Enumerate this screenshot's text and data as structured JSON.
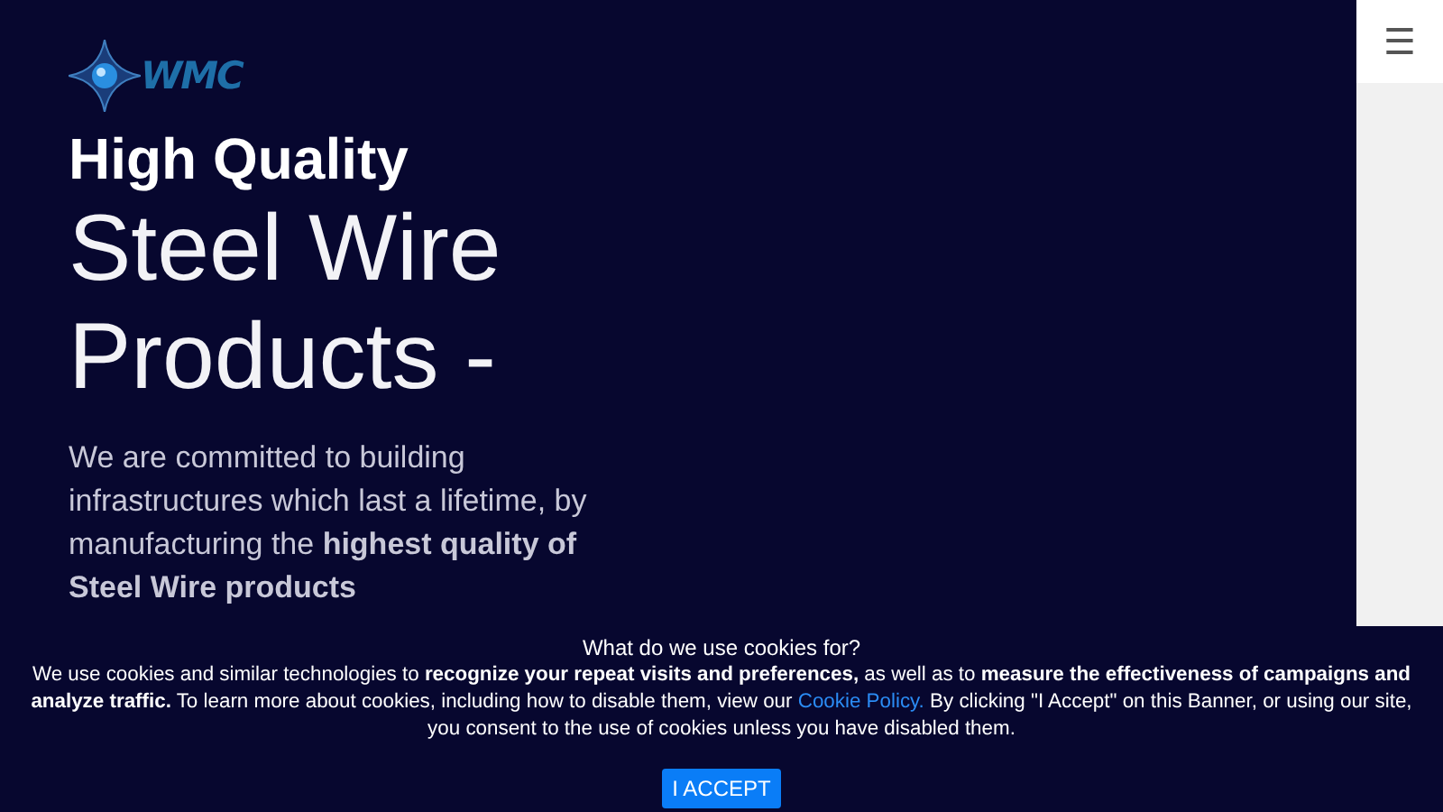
{
  "logo": {
    "text": "WMC"
  },
  "hero": {
    "kicker": "High Quality",
    "title_lines": [
      "Steel Wire",
      "Products -"
    ],
    "paragraph": "We are committed to building infrastructures which last a lifetime, by manufacturing the **highest quality of Steel Wire products**"
  },
  "menu_button": {
    "label": "☰"
  },
  "cookie_banner": {
    "heading": "What do we use cookies for?",
    "text_before": "We use cookies and similar technologies to **recognize your repeat visits and preferences,** as well as to **measure the effectiveness of campaigns and analyze traffic.** To learn more about cookies, including how to disable them, view our",
    "link": "Cookie Policy.",
    "text_after": "By clicking \"I Accept\" on this Banner, or using our site, you consent to the use of cookies unless you have disabled them.",
    "button": "I ACCEPT"
  }
}
